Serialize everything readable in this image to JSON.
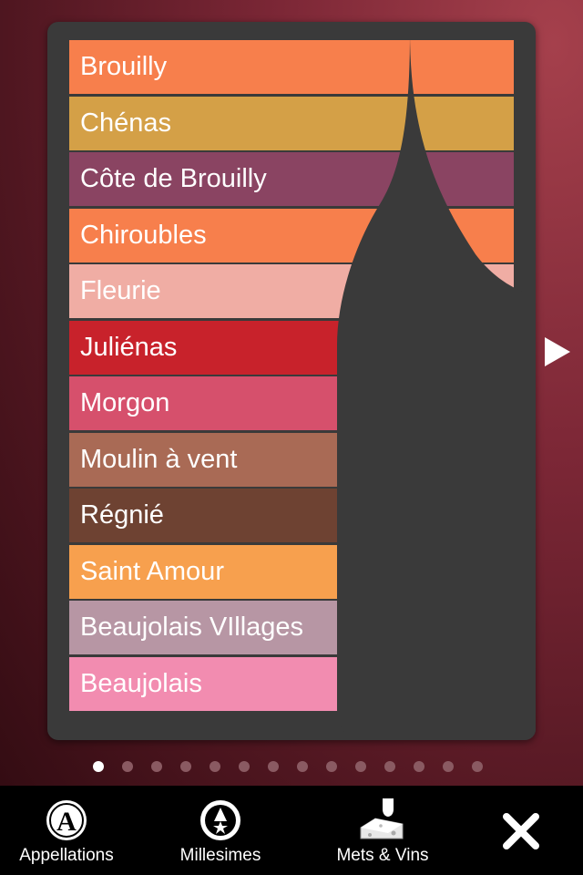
{
  "appellations": [
    {
      "name": "Brouilly",
      "color": "#f77f4c"
    },
    {
      "name": "Chénas",
      "color": "#d4a047"
    },
    {
      "name": "Côte de Brouilly",
      "color": "#8a4462"
    },
    {
      "name": "Chiroubles",
      "color": "#f77f4c"
    },
    {
      "name": "Fleurie",
      "color": "#f0ada4"
    },
    {
      "name": "Juliénas",
      "color": "#c8222b"
    },
    {
      "name": "Morgon",
      "color": "#d6506c"
    },
    {
      "name": "Moulin à vent",
      "color": "#a96a55"
    },
    {
      "name": "Régnié",
      "color": "#6e4232"
    },
    {
      "name": "Saint Amour",
      "color": "#f7a04e"
    },
    {
      "name": "Beaujolais VIllages",
      "color": "#b796a4"
    },
    {
      "name": "Beaujolais",
      "color": "#f28cb0"
    }
  ],
  "pager": {
    "count": 14,
    "active": 0
  },
  "tabs": {
    "appellations": "Appellations",
    "millesimes": "Millesimes",
    "mets_vins": "Mets & Vins"
  },
  "icons": {
    "next": "next-arrow-icon",
    "close": "close-icon"
  }
}
